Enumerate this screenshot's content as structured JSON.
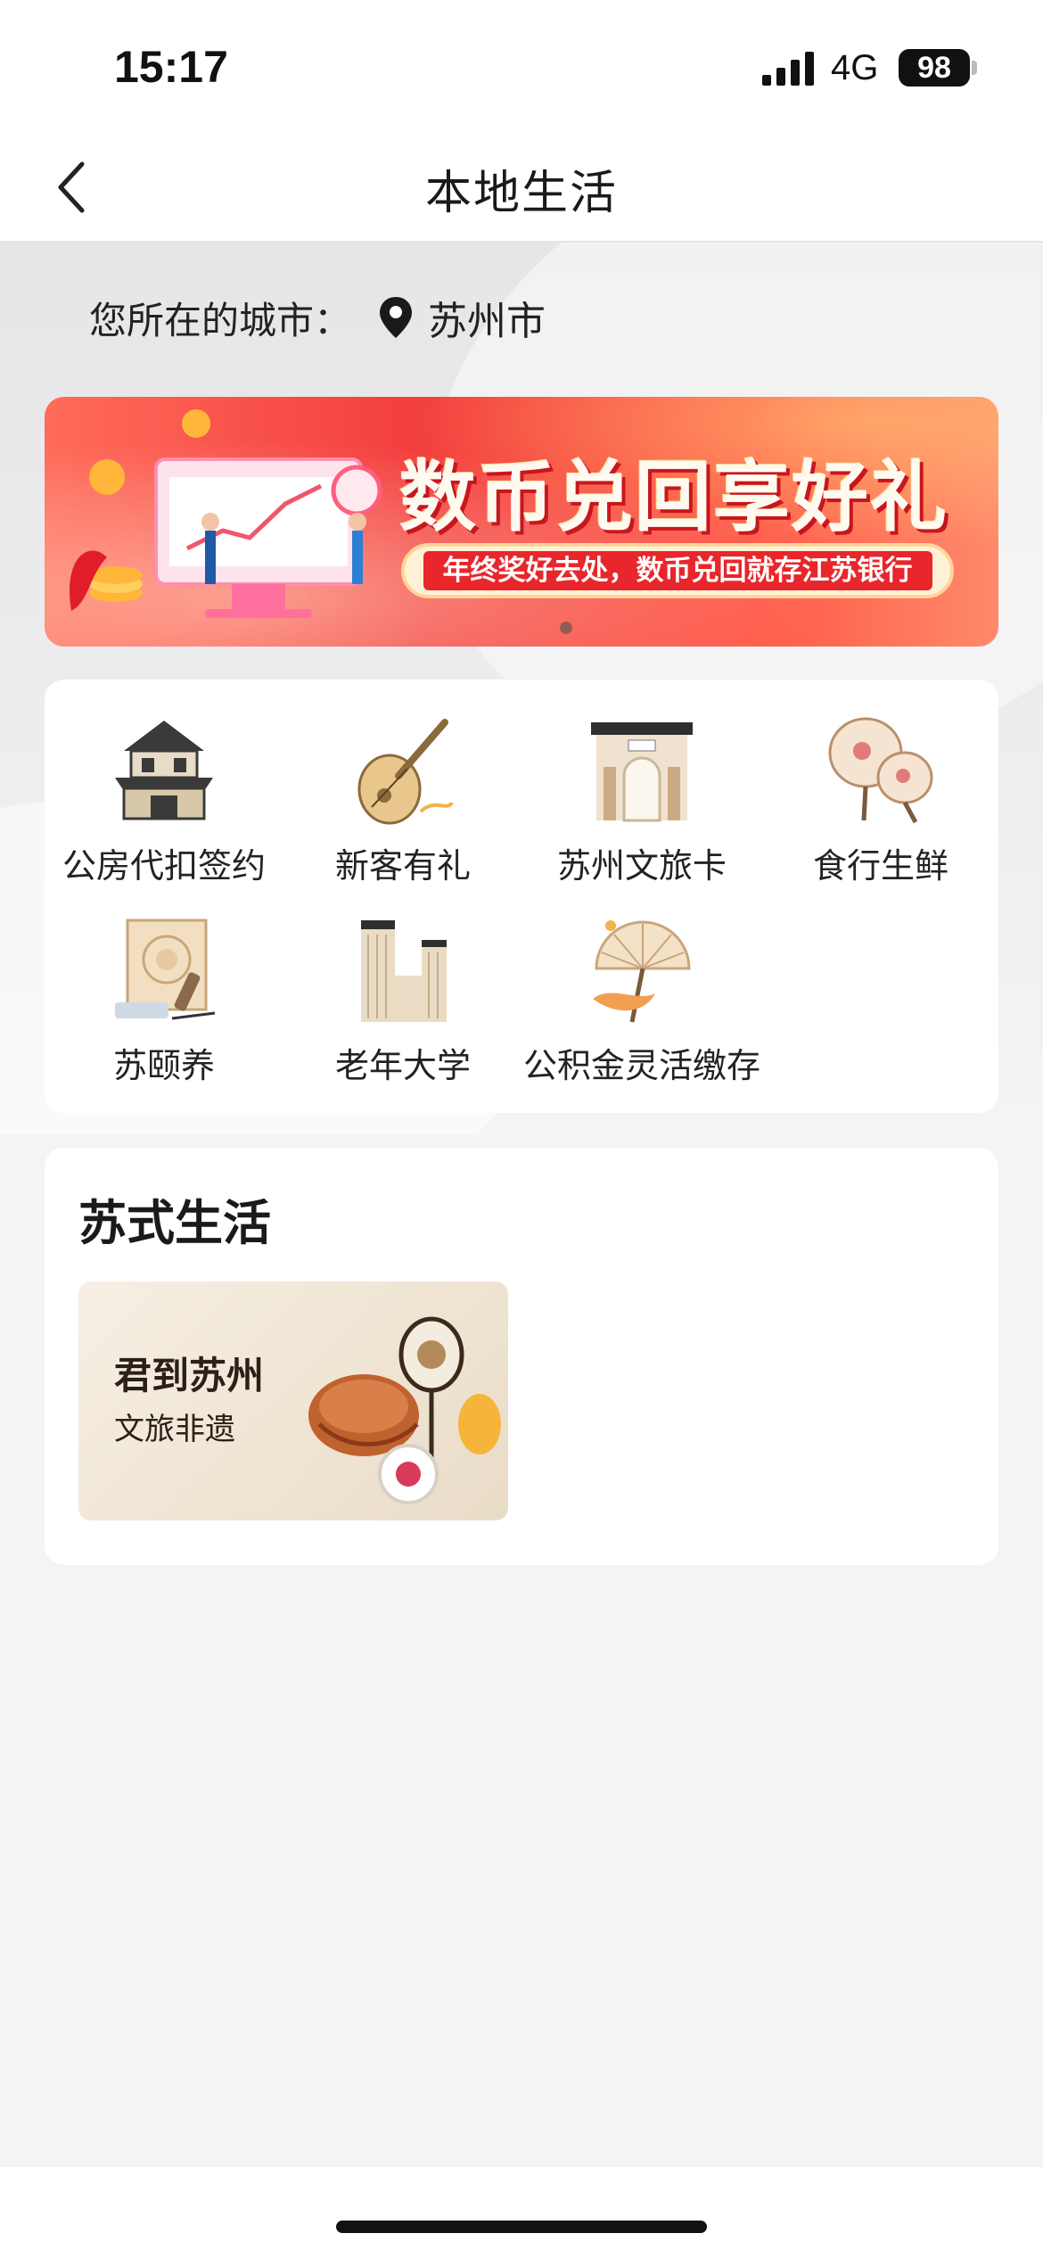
{
  "status": {
    "time": "15:17",
    "network": "4G",
    "battery": "98"
  },
  "nav": {
    "title": "本地生活"
  },
  "city": {
    "label": "您所在的城市：",
    "value": "苏州市"
  },
  "banner": {
    "title": "数币兑回享好礼",
    "subtitle": "年终奖好去处，数币兑回就存江苏银行",
    "slide_count": 1,
    "active_slide": 1
  },
  "services": [
    {
      "label": "公房代扣签约",
      "icon": "pavilion-icon"
    },
    {
      "label": "新客有礼",
      "icon": "pipa-icon"
    },
    {
      "label": "苏州文旅卡",
      "icon": "gate-icon"
    },
    {
      "label": "食行生鲜",
      "icon": "round-fan-icon"
    },
    {
      "label": "苏颐养",
      "icon": "scroll-painting-icon"
    },
    {
      "label": "老年大学",
      "icon": "building-icon"
    },
    {
      "label": "公积金灵活缴存",
      "icon": "paper-umbrella-icon"
    }
  ],
  "suzhou_life": {
    "title": "苏式生活",
    "tiles": [
      {
        "title": "君到苏州",
        "subtitle": "文旅非遗"
      }
    ]
  },
  "colors": {
    "banner_red": "#f23d3d",
    "page_bg": "#f4f4f6",
    "card_bg": "#ffffff"
  }
}
